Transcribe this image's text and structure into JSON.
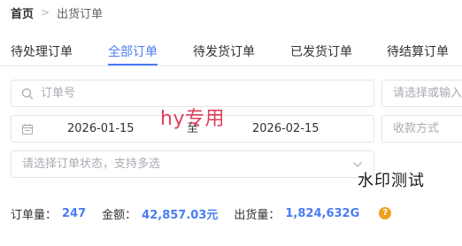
{
  "breadcrumb": {
    "home": "首页",
    "separator": ">",
    "current": "出货订单"
  },
  "tabs": [
    {
      "label": "待处理订单",
      "active": false
    },
    {
      "label": "全部订单",
      "active": true
    },
    {
      "label": "待发货订单",
      "active": false
    },
    {
      "label": "已发货订单",
      "active": false
    },
    {
      "label": "待结算订单",
      "active": false
    }
  ],
  "filters": {
    "order_no_placeholder": "订单号",
    "right_select_placeholder": "请选择或输入",
    "date_start": "2026-01-15",
    "date_separator": "至",
    "date_end": "2026-02-15",
    "payment_placeholder": "收款方式",
    "status_placeholder": "请选择订单状态，支持多选"
  },
  "watermarks": {
    "red": "hy专用",
    "black": "水印测试"
  },
  "stats": {
    "orders_label": "订单量：",
    "orders_value": "247",
    "amount_label": "金额：",
    "amount_value": "42,857.03元",
    "shipped_label": "出货量：",
    "shipped_value": "1,824,632G",
    "help_glyph": "?"
  },
  "colors": {
    "accent": "#4a7cf3",
    "warning": "#f0a020",
    "watermark_red": "#e0405a"
  }
}
